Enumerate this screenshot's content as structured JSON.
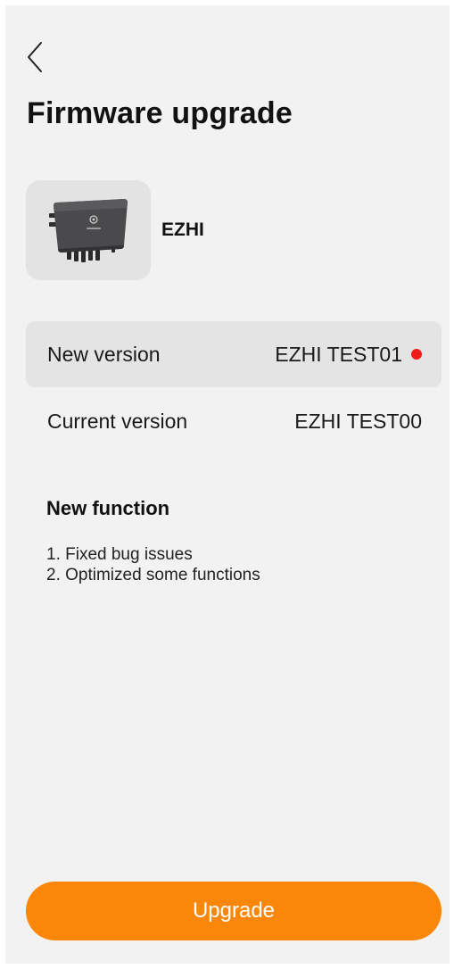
{
  "header": {
    "back_icon": "chevron-left-icon",
    "title": "Firmware upgrade"
  },
  "device": {
    "image_icon": "inverter-device-icon",
    "name": "EZHI"
  },
  "versions": {
    "new_label": "New version",
    "new_value": "EZHI TEST01",
    "new_indicator_color": "#f01c1c",
    "current_label": "Current version",
    "current_value": "EZHI TEST00"
  },
  "new_function": {
    "title": "New function",
    "items": [
      "1. Fixed bug issues",
      "2. Optimized some functions"
    ]
  },
  "actions": {
    "upgrade_label": "Upgrade",
    "accent_color": "#fa860a"
  }
}
